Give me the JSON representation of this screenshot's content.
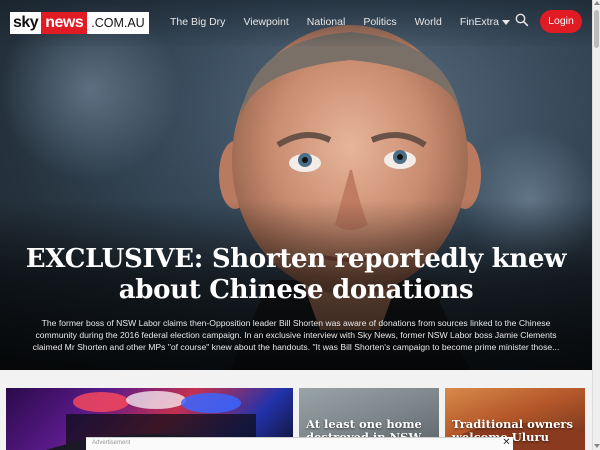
{
  "site": {
    "logo": {
      "part1": "sky",
      "part2": "news",
      "part3": ".COM.AU"
    },
    "brand_red": "#e01b23"
  },
  "nav": {
    "items": [
      {
        "label": "The Big Dry"
      },
      {
        "label": "Viewpoint"
      },
      {
        "label": "National"
      },
      {
        "label": "Politics"
      },
      {
        "label": "World"
      },
      {
        "label": "FinExtra"
      }
    ],
    "search_icon": "search-icon",
    "login_label": "Login"
  },
  "hero": {
    "title": "EXCLUSIVE: Shorten reportedly knew about Chinese donations",
    "summary": "The former boss of NSW Labor claims then-Opposition leader Bill Shorten was aware of donations from sources linked to the Chinese community during the 2016 federal election campaign. In an exclusive interview with Sky News, former NSW Labor boss Jamie Clements claimed Mr Shorten and other MPs \"of course\" knew about the handouts. \"It was Bill Shorten's campaign to become prime minister those..."
  },
  "cards": [
    {
      "title": ""
    },
    {
      "title": "At least one home destroyed in NSW"
    },
    {
      "title": "Traditional owners welcome Uluru climb"
    }
  ],
  "ad": {
    "label": "Advertisement",
    "close": "✕"
  }
}
